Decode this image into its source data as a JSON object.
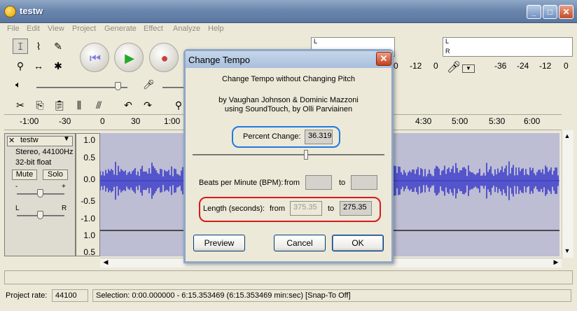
{
  "window": {
    "title": "testw",
    "controls": {
      "minimize": "_",
      "maximize": "□",
      "close": "✕"
    }
  },
  "menu": [
    "File",
    "Edit",
    "View",
    "Project",
    "Generate",
    "Effect",
    "Analyze",
    "Help"
  ],
  "meters": {
    "playback": {
      "channel_top": "L",
      "channel_bottom": "R"
    },
    "record": {
      "channel_top": "L",
      "channel_bottom": "R"
    },
    "scale": [
      "-36",
      "-24",
      "-12",
      "0",
      "-36",
      "-24",
      "-12",
      "0"
    ]
  },
  "ruler": {
    "labels": [
      "-1:00",
      "-30",
      "0",
      "30",
      "1:00",
      "4:30",
      "5:00",
      "5:30",
      "6:00"
    ]
  },
  "track": {
    "name": "testw",
    "format": "Stereo, 44100Hz",
    "bitdepth": "32-bit float",
    "mute_label": "Mute",
    "solo_label": "Solo",
    "gain_minus": "-",
    "gain_plus": "+",
    "pan_left": "L",
    "pan_right": "R",
    "vruler": [
      "1.0",
      "0.5",
      "0.0",
      "-0.5",
      "-1.0"
    ],
    "vruler2": [
      "1.0",
      "0.5"
    ]
  },
  "status": {
    "project_rate_label": "Project rate:",
    "project_rate_value": "44100",
    "selection": "Selection: 0:00.000000 - 6:15.353469 (6:15.353469 min:sec)  [Snap-To Off]"
  },
  "dialog": {
    "title": "Change Tempo",
    "close": "✕",
    "heading": "Change Tempo without Changing Pitch",
    "credit_line1": "by Vaughan Johnson & Dominic Mazzoni",
    "credit_line2": "using SoundTouch, by Olli Parviainen",
    "percent_label": "Percent Change:",
    "percent_value": "36.319",
    "percent_slider": 0.59,
    "bpm_label": "Beats per Minute (BPM):",
    "bpm_from_label": "from",
    "bpm_from_value": "",
    "bpm_to_label": "to",
    "bpm_to_value": "",
    "length_label": "Length (seconds):",
    "length_from_label": "from",
    "length_from_value": "375.35",
    "length_to_label": "to",
    "length_to_value": "275.35",
    "preview_label": "Preview",
    "cancel_label": "Cancel",
    "ok_label": "OK"
  },
  "colors": {
    "waveform": "#3232c8",
    "highlight_percent": "#1f7be0",
    "highlight_length": "#d8191b"
  }
}
